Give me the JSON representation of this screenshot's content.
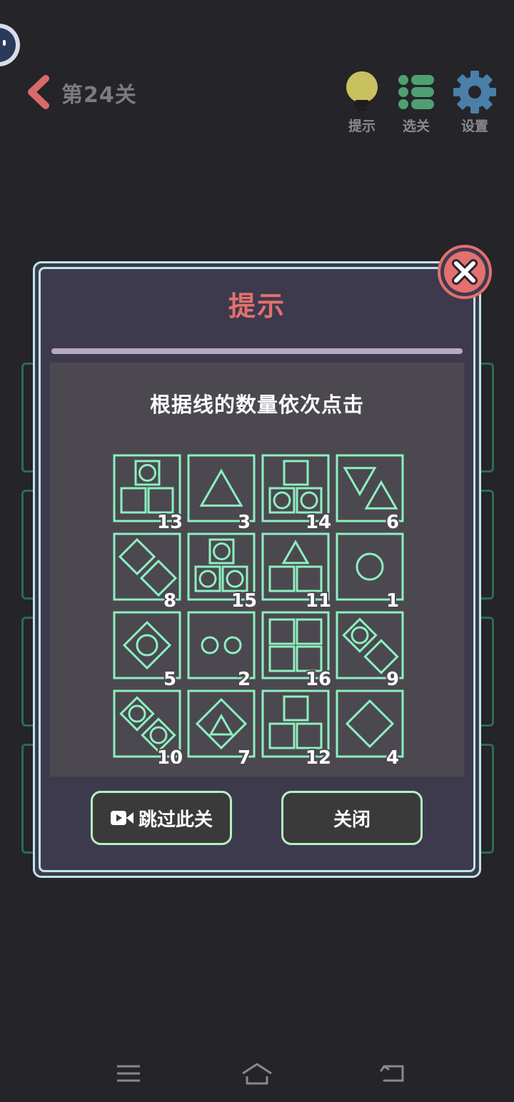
{
  "header": {
    "level_title": "第24关",
    "tools": [
      {
        "label": "提示",
        "icon": "lightbulb-icon"
      },
      {
        "label": "选关",
        "icon": "list-icon"
      },
      {
        "label": "设置",
        "icon": "gear-icon"
      }
    ]
  },
  "dialog": {
    "title": "提示",
    "hint_text": "根据线的数量依次点击",
    "tiles": [
      {
        "shape": "square-circle-two-squares",
        "number": "13"
      },
      {
        "shape": "triangle",
        "number": "3"
      },
      {
        "shape": "square-two-circle-squares",
        "number": "14"
      },
      {
        "shape": "two-triangles",
        "number": "6"
      },
      {
        "shape": "two-diamonds",
        "number": "8"
      },
      {
        "shape": "three-circle-squares",
        "number": "15"
      },
      {
        "shape": "triangle-two-squares",
        "number": "11"
      },
      {
        "shape": "circle",
        "number": "1"
      },
      {
        "shape": "diamond-circle",
        "number": "5"
      },
      {
        "shape": "two-circles",
        "number": "2"
      },
      {
        "shape": "four-squares",
        "number": "16"
      },
      {
        "shape": "diamond-circle-diamond",
        "number": "9"
      },
      {
        "shape": "two-diamond-circles",
        "number": "10"
      },
      {
        "shape": "diamond-triangle",
        "number": "7"
      },
      {
        "shape": "three-squares",
        "number": "12"
      },
      {
        "shape": "diamond",
        "number": "4"
      }
    ],
    "skip_button": "跳过此关",
    "close_button": "关闭"
  },
  "colors": {
    "background": "#252428",
    "dialog": "#3e3a4e",
    "panel": "#4c484f",
    "line_green": "#8cf0c0",
    "title_red": "#e4706e",
    "button_border": "#b6f0c0"
  }
}
